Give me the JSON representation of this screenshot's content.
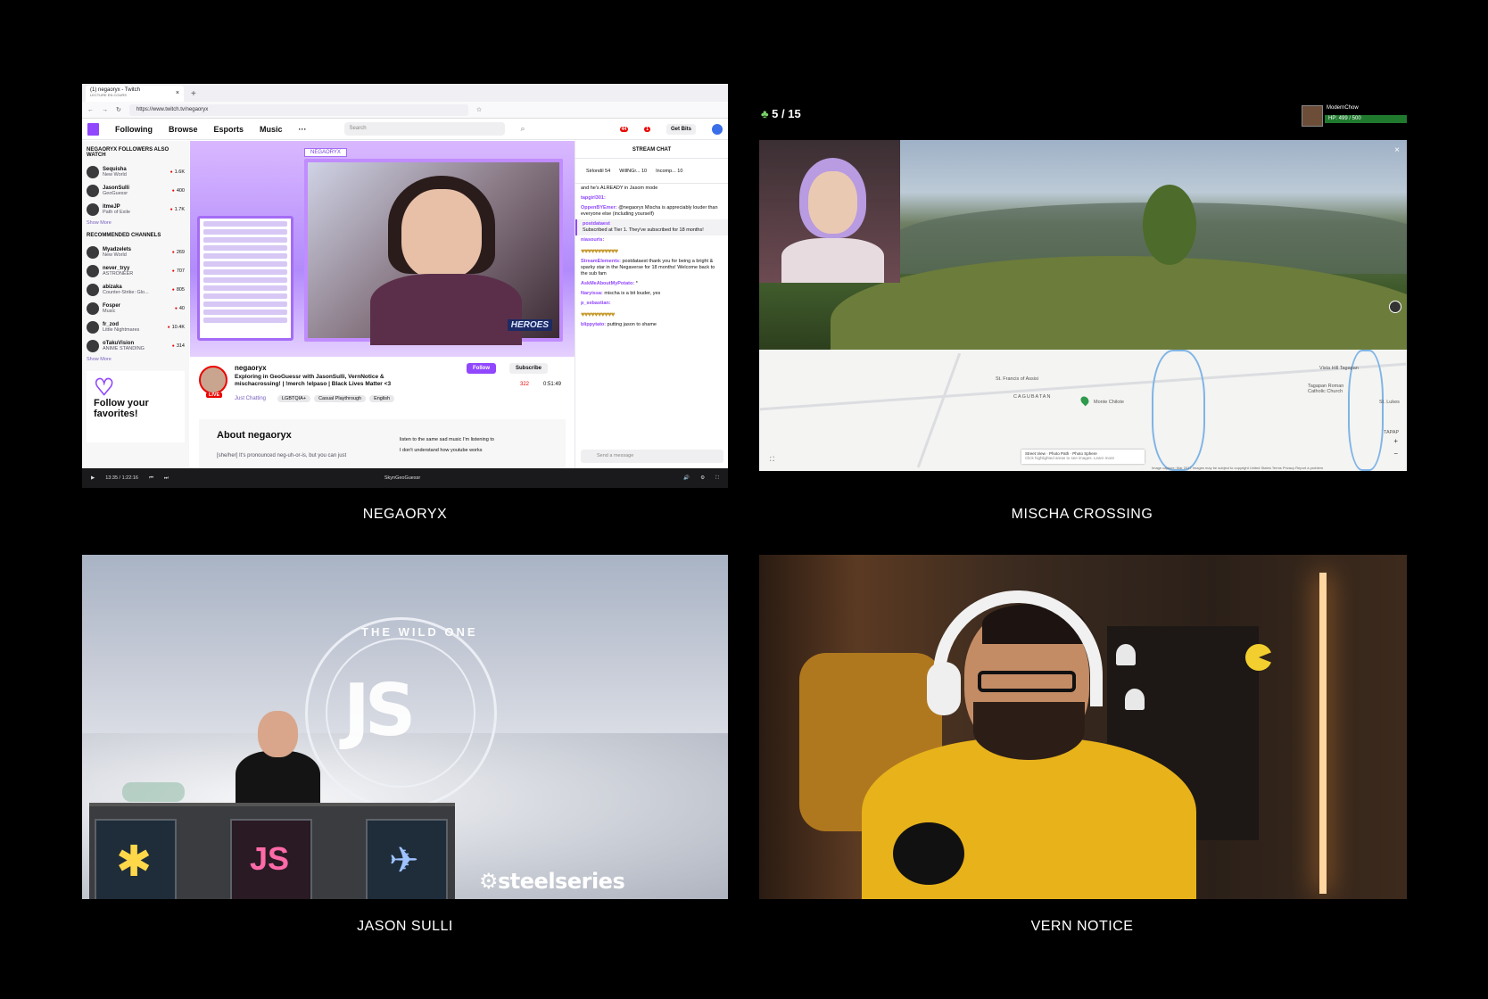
{
  "captions": {
    "p1": "NEGAORYX",
    "p2": "MISCHA CROSSING",
    "p3": "JASON SULLI",
    "p4": "VERN NOTICE"
  },
  "browser": {
    "tab_title": "(1) negaoryx - Twitch",
    "tab_subtitle": "LECTURE EN COURS",
    "url": "https://www.twitch.tv/negaoryx"
  },
  "twitch": {
    "nav": [
      "Following",
      "Browse",
      "Esports",
      "Music",
      "···"
    ],
    "search_placeholder": "Search",
    "notif_count": "44",
    "inbox_count": "1",
    "get_bits": "Get Bits",
    "sidebar": {
      "followers_heading": "NEGAORYX FOLLOWERS ALSO WATCH",
      "followers": [
        {
          "name": "Sequisha",
          "game": "New World",
          "viewers": "1.6K"
        },
        {
          "name": "JasonSulli",
          "game": "GeoGuessr",
          "viewers": "400"
        },
        {
          "name": "itmeJP",
          "game": "Path of Exile",
          "viewers": "1.7K"
        }
      ],
      "show_more_1": "Show More",
      "recommended_heading": "RECOMMENDED CHANNELS",
      "recommended": [
        {
          "name": "Myadzelets",
          "game": "New World",
          "viewers": "269"
        },
        {
          "name": "never_tryy",
          "game": "ASTRONEER",
          "viewers": "707"
        },
        {
          "name": "abizaka",
          "game": "Counter-Strike: Glo...",
          "viewers": "805"
        },
        {
          "name": "Fosper",
          "game": "Music",
          "viewers": "40"
        },
        {
          "name": "fr_zod",
          "game": "Little Nightmares",
          "viewers": "10.4K"
        },
        {
          "name": "oTakuVision",
          "game": "ANIME STANDING",
          "viewers": "314"
        }
      ],
      "show_more_2": "Show More",
      "follow_card": "Follow your favorites!"
    },
    "player": {
      "overlay_tag": "NEGAORYX",
      "heroes_label": "HEROES"
    },
    "info": {
      "channel": "negaoryx",
      "live": "LIVE",
      "title": "Exploring in GeoGuessr with JasonSulli, VernNotice & mischacrossing! | !merch !elpaso | Black Lives Matter <3",
      "category": "Just Chatting",
      "tags": [
        "LGBTQIA+",
        "Casual Playthrough",
        "English"
      ],
      "follow": "Follow",
      "subscribe": "Subscribe",
      "viewers": "322",
      "uptime": "0:51:49",
      "about_heading": "About negaoryx",
      "about_desc": "[she/her] It's pronounced neg-uh-or-is, but you can just",
      "about_side_1": "listen to the same sad music I'm listening to",
      "about_side_2": "I don't understand how youtube works"
    },
    "chat": {
      "header": "STREAM CHAT",
      "gifters": [
        {
          "name": "Sirlondil",
          "count": "54"
        },
        {
          "name": "WillNGr...",
          "count": "10"
        },
        {
          "name": "Incomp...",
          "count": "10"
        }
      ],
      "messages": [
        {
          "user": "",
          "text": "and he's ALREADY in Jasom mode"
        },
        {
          "user": "tapgirl301:",
          "text": ""
        },
        {
          "user": "OppenBYEmer:",
          "text": "@negaoryx Mischa is appreciably louder than everyone else (including yourself)"
        }
      ],
      "sub": {
        "user": "postdataest",
        "text": "Subscribed at Tier 1. They've subscribed for 18 months!"
      },
      "messages2": [
        {
          "user": "niasouris:",
          "text": ""
        },
        {
          "user": "StreamElements:",
          "text": "postdataest thank you for being a bright & sparky star in the Negaverse for 18 months! Welcome back to the sub fam"
        },
        {
          "user": "AskMeAboutMyPotato:",
          "text": "*"
        },
        {
          "user": "Naryissa:",
          "text": "mischa is a bit louder, yes"
        },
        {
          "user": "p_sebastian:",
          "text": ""
        },
        {
          "user": "blippytato:",
          "text": "putting jason to shame"
        }
      ],
      "send_placeholder": "Send a message"
    },
    "controls": {
      "time": "13:35 / 1:22:16",
      "caption": "SkynGeoGuessr"
    }
  },
  "geo": {
    "round": "5",
    "round_total": "/ 15",
    "player_name": "ModernChow",
    "hp": "HP: 499 / 500",
    "map_labels": {
      "a": "St. Francis of Assisi",
      "b": "CAGUBATAN",
      "c": "Monte Chilote",
      "d": "Vista Hill Tagapan",
      "e": "Tagapan Roman Catholic Church",
      "f": "St. Lukes",
      "g": "TAPAP"
    },
    "legend": [
      "Street View",
      "Photo Path",
      "Photo Sphere"
    ],
    "legend_note": "Click highlighted areas to see images. Learn more",
    "footer": "Image capture: Mar 2017   Images may be subject to copyright   United States   Terms   Privacy   Report a problem"
  },
  "jason": {
    "emblem_text": "JS",
    "ring_text": "THE WILD ONE",
    "sponsor": "steelseries"
  },
  "colors": {
    "twitch_purple": "#9147ff",
    "live_red": "#eb0400",
    "hp_green": "#1f7a2e"
  }
}
